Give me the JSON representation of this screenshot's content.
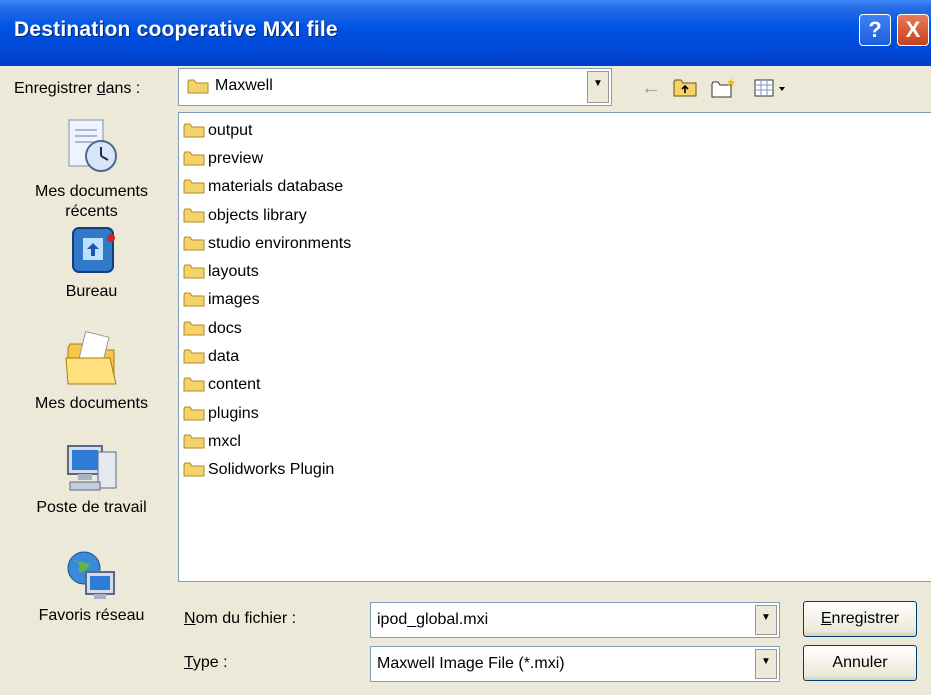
{
  "window": {
    "title": "Destination cooperative MXI file"
  },
  "title_buttons": {
    "help": "?",
    "close": "X"
  },
  "save_in": {
    "label_pre": "Enregistrer ",
    "label_key": "d",
    "label_post": "ans :",
    "value": "Maxwell"
  },
  "toolbar": {
    "back_icon": "←",
    "up_icon": "⇧",
    "new_folder_icon": "★",
    "views_icon": "▾"
  },
  "places": [
    {
      "label": "Mes documents récents",
      "icon": "recent-documents-icon"
    },
    {
      "label": "Bureau",
      "icon": "desktop-icon"
    },
    {
      "label": "Mes documents",
      "icon": "my-documents-icon"
    },
    {
      "label": "Poste de travail",
      "icon": "my-computer-icon"
    },
    {
      "label": "Favoris réseau",
      "icon": "network-places-icon"
    }
  ],
  "files": [
    "output",
    "preview",
    "materials database",
    "objects library",
    "studio environments",
    "layouts",
    "images",
    "docs",
    "data",
    "content",
    "plugins",
    "mxcl",
    "Solidworks Plugin"
  ],
  "filename": {
    "label_key": "N",
    "label_post": "om du fichier :",
    "value": "ipod_global.mxi"
  },
  "filetype": {
    "label_key": "T",
    "label_post": "ype :",
    "value": "Maxwell Image File (*.mxi)"
  },
  "buttons": {
    "save_key": "E",
    "save_post": "nregistrer",
    "cancel": "Annuler"
  }
}
